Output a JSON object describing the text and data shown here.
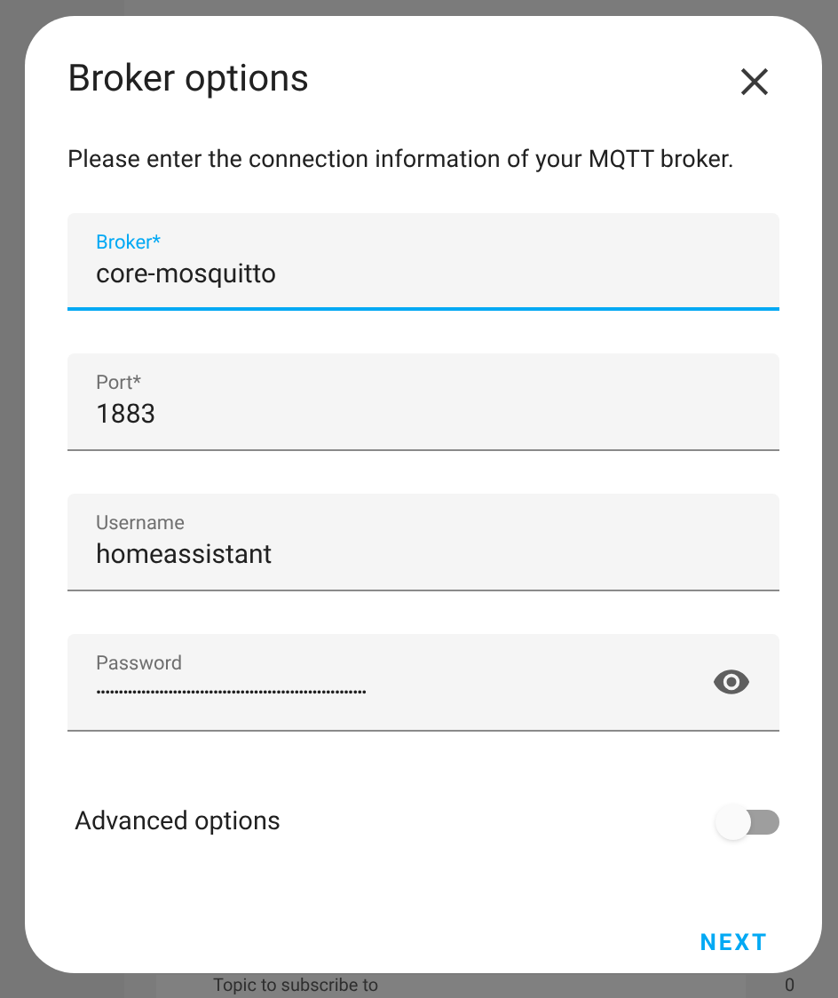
{
  "background": {
    "field_label": "Topic to subscribe to",
    "field_value": "0"
  },
  "dialog": {
    "title": "Broker options",
    "description": "Please enter the connection information of your MQTT broker.",
    "fields": [
      {
        "label": "Broker*",
        "value": "core-mosquitto",
        "focused": true,
        "kind": "text"
      },
      {
        "label": "Port*",
        "value": "1883",
        "focused": false,
        "kind": "text"
      },
      {
        "label": "Username",
        "value": "homeassistant",
        "focused": false,
        "kind": "text"
      },
      {
        "label": "Password",
        "value": "••••••••••••••••••••••••••••••••••••••••••••••••••••••••••••",
        "focused": false,
        "kind": "password"
      }
    ],
    "toggle": {
      "label": "Advanced options",
      "on": false
    },
    "button": "NEXT"
  }
}
